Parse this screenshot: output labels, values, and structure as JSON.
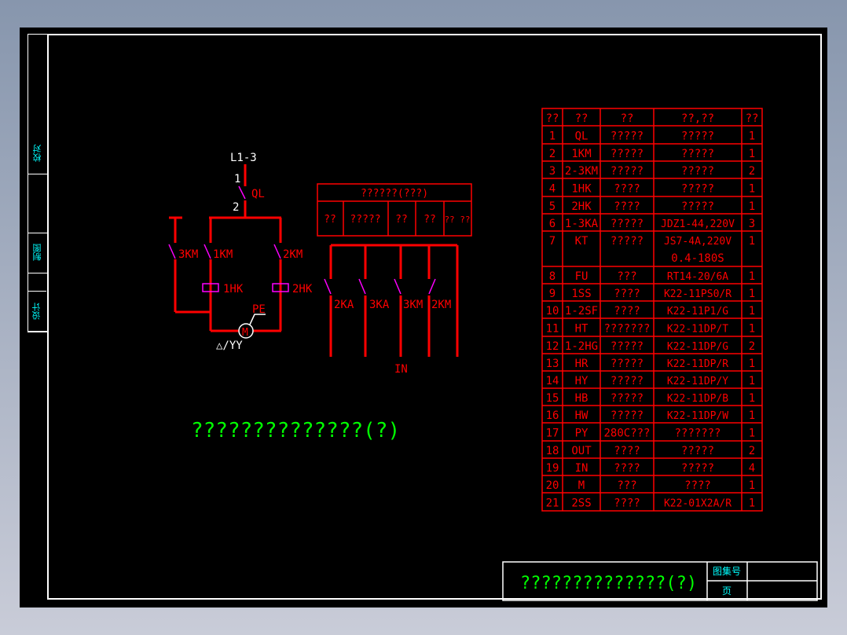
{
  "side_labels": [
    "校对",
    "制图",
    "设计"
  ],
  "schematic": {
    "supply": "L1-3",
    "ql_top": "1",
    "ql_bottom": "2",
    "ql": "QL",
    "km3": "3KM",
    "km1": "1KM",
    "km2": "2KM",
    "hk1": "1HK",
    "hk2": "2HK",
    "pe": "PE",
    "motor": "M",
    "connection": "△/YY",
    "contacts": [
      "2KA",
      "3KA",
      "3KM",
      "2KM"
    ],
    "in_label": "IN",
    "io_table": {
      "title": "??????(???)",
      "cols": [
        "??",
        "?????",
        "??",
        "??",
        "??\n??"
      ]
    }
  },
  "caption": "??????????????(?)",
  "parts_table": {
    "headers": [
      "??",
      "??",
      "??",
      "??,??",
      "??"
    ],
    "rows": [
      [
        "1",
        "QL",
        "?????",
        "?????",
        "1"
      ],
      [
        "2",
        "1KM",
        "?????",
        "?????",
        "1"
      ],
      [
        "3",
        "2-3KM",
        "?????",
        "?????",
        "2"
      ],
      [
        "4",
        "1HK",
        "????",
        "?????",
        "1"
      ],
      [
        "5",
        "2HK",
        "????",
        "?????",
        "1"
      ],
      [
        "6",
        "1-3KA",
        "?????",
        "JDZ1-44,220V",
        "3"
      ],
      [
        "7",
        "KT",
        "?????",
        "JS7-4A,220V 0.4-180S",
        "1"
      ],
      [
        "8",
        "FU",
        "???",
        "RT14-20/6A",
        "1"
      ],
      [
        "9",
        "1SS",
        "????",
        "K22-11PS0/R",
        "1"
      ],
      [
        "10",
        "1-2SF",
        "????",
        "K22-11P1/G",
        "1"
      ],
      [
        "11",
        "HT",
        "???????",
        "K22-11DP/T",
        "1"
      ],
      [
        "12",
        "1-2HG",
        "?????",
        "K22-11DP/G",
        "2"
      ],
      [
        "13",
        "HR",
        "?????",
        "K22-11DP/R",
        "1"
      ],
      [
        "14",
        "HY",
        "?????",
        "K22-11DP/Y",
        "1"
      ],
      [
        "15",
        "HB",
        "?????",
        "K22-11DP/B",
        "1"
      ],
      [
        "16",
        "HW",
        "?????",
        "K22-11DP/W",
        "1"
      ],
      [
        "17",
        "PY",
        "280C???",
        "???????",
        "1"
      ],
      [
        "18",
        "OUT",
        "????",
        "?????",
        "2"
      ],
      [
        "19",
        "IN",
        "????",
        "?????",
        "4"
      ],
      [
        "20",
        "M",
        "???",
        "????",
        "1"
      ],
      [
        "21",
        "2SS",
        "????",
        "K22-01X2A/R",
        "1"
      ]
    ]
  },
  "title_block": {
    "title": "??????????????(?)",
    "atlas_no_label": "图集号",
    "page_label": "页",
    "atlas_no": "",
    "page": ""
  }
}
